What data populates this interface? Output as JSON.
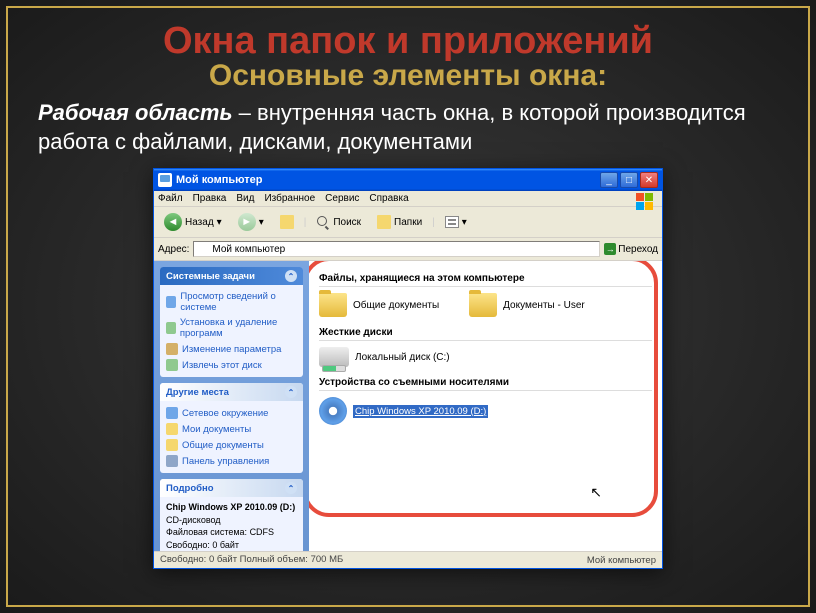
{
  "slide": {
    "title": "Окна папок и приложений",
    "subtitle": "Основные элементы окна:",
    "desc_bold": "Рабочая область",
    "desc_rest": " – внутренняя часть окна, в которой производится работа с файлами, дисками, документами"
  },
  "window": {
    "title": "Мой компьютер",
    "menu": [
      "Файл",
      "Правка",
      "Вид",
      "Избранное",
      "Сервис",
      "Справка"
    ],
    "toolbar": {
      "back": "Назад",
      "search": "Поиск",
      "folders": "Папки"
    },
    "addressbar": {
      "label": "Адрес:",
      "value": "Мой компьютер",
      "go": "Переход"
    },
    "sidebar": {
      "tasks_header": "Системные задачи",
      "tasks": [
        "Просмотр сведений о системе",
        "Установка и удаление программ",
        "Изменение параметра",
        "Извлечь этот диск"
      ],
      "places_header": "Другие места",
      "places": [
        "Сетевое окружение",
        "Мои документы",
        "Общие документы",
        "Панель управления"
      ],
      "details_header": "Подробно",
      "details": {
        "title": "Chip Windows XP 2010.09 (D:)",
        "type": "CD-дисковод",
        "fs_label": "Файловая система:",
        "fs_value": "CDFS",
        "free_label": "Свободно:",
        "free_value": "0 байт",
        "total_label": "Полный объем:",
        "total_value": "700 МБ"
      }
    },
    "content": {
      "section1": "Файлы, хранящиеся на этом компьютере",
      "shared_docs": "Общие документы",
      "user_docs": "Документы - User",
      "section2": "Жесткие диски",
      "hdd_label": "Локальный диск (C:)",
      "section3": "Устройства со съемными носителями",
      "cd_label": "Chip Windows XP 2010.09 (D:)"
    },
    "statusbar": {
      "left": "Свободно: 0 байт Полный объем: 700 МБ",
      "right": "Мой компьютер"
    }
  }
}
